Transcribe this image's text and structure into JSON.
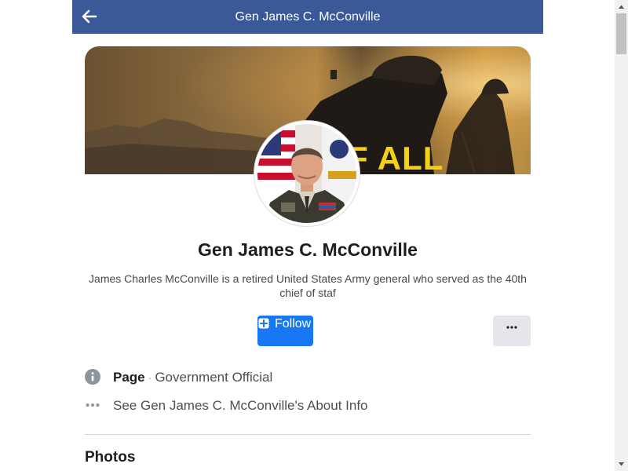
{
  "header": {
    "title": "Gen James C. McConville",
    "back_icon": "arrow-left-icon",
    "background_color": "#3b5998"
  },
  "cover": {
    "overlay_text": "F ALL",
    "accent_color": "#f3d117"
  },
  "profile": {
    "name": "Gen James C. McConville",
    "bio": "James Charles McConville is a retired United States Army general who served as the 40th chief of staf"
  },
  "actions": {
    "follow_label": "Follow",
    "follow_icon": "plus-square-icon",
    "follow_color": "#1877f2",
    "more_icon": "ellipsis-icon"
  },
  "info": {
    "page_label": "Page",
    "separator": "·",
    "category": "Government Official",
    "about_link": "See Gen James C. McConville's About Info",
    "info_icon": "info-circle-icon",
    "about_icon": "ellipsis-icon"
  },
  "sections": {
    "photos_title": "Photos"
  }
}
